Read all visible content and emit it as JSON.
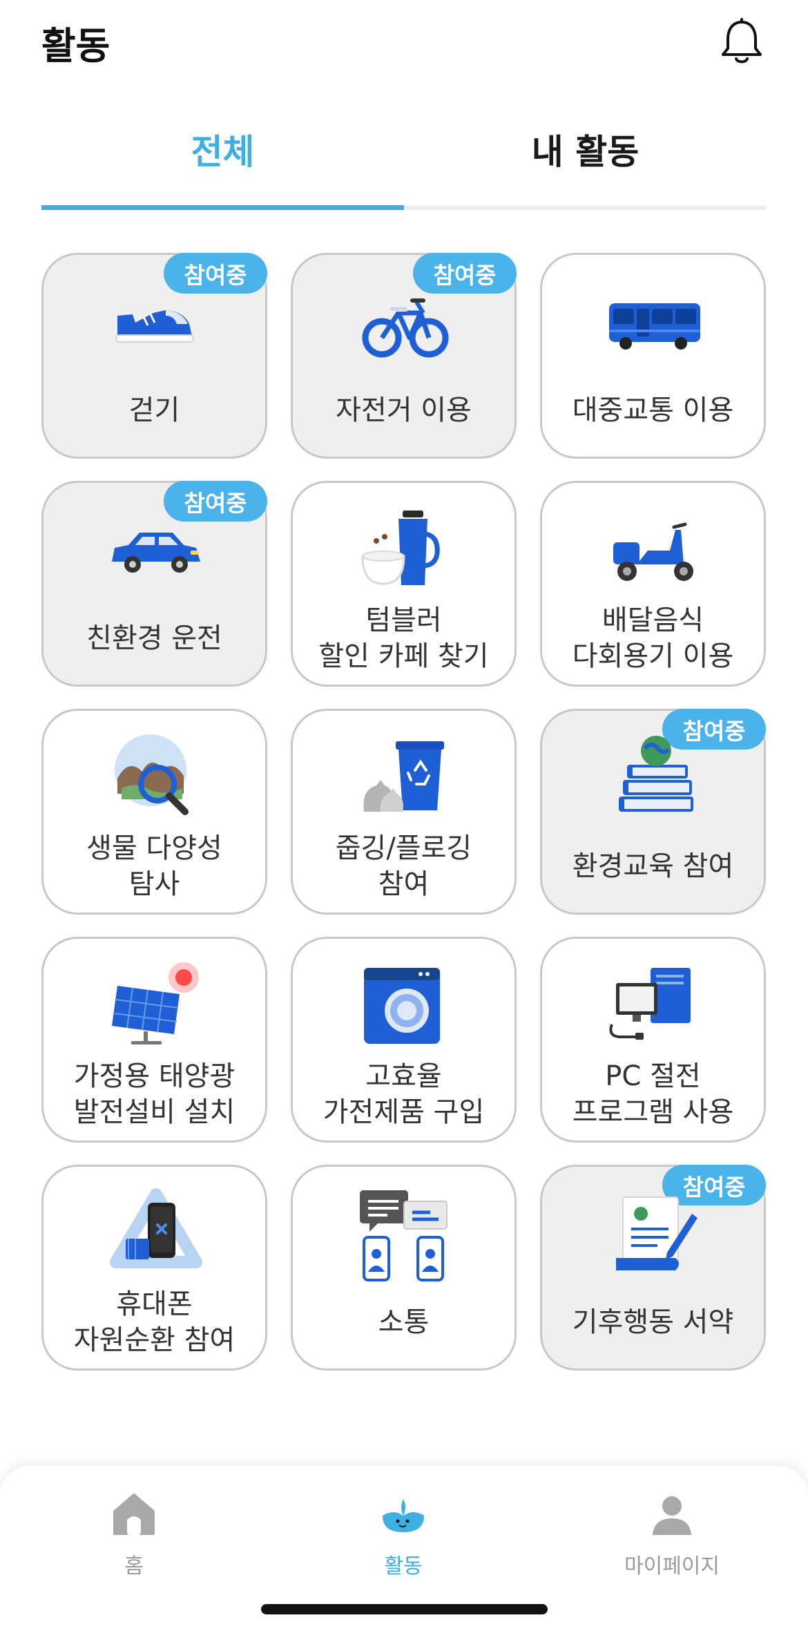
{
  "header": {
    "title": "활동"
  },
  "tabs": [
    {
      "label": "전체",
      "active": true
    },
    {
      "label": "내 활동",
      "active": false
    }
  ],
  "badge_label": "참여중",
  "activities": [
    {
      "label": "걷기",
      "icon": "shoe-icon",
      "joined": true
    },
    {
      "label": "자전거 이용",
      "icon": "bicycle-icon",
      "joined": true
    },
    {
      "label": "대중교통 이용",
      "icon": "bus-icon",
      "joined": false
    },
    {
      "label": "친환경 운전",
      "icon": "car-icon",
      "joined": true
    },
    {
      "label": "텀블러\n할인 카페 찾기",
      "icon": "tumbler-icon",
      "joined": false
    },
    {
      "label": "배달음식\n다회용기 이용",
      "icon": "scooter-icon",
      "joined": false
    },
    {
      "label": "생물 다양성\n탐사",
      "icon": "magnifier-globe-icon",
      "joined": false
    },
    {
      "label": "줍깅/플로깅\n참여",
      "icon": "recycle-bin-icon",
      "joined": false
    },
    {
      "label": "환경교육 참여",
      "icon": "books-globe-icon",
      "joined": true
    },
    {
      "label": "가정용 태양광\n발전설비 설치",
      "icon": "solar-panel-icon",
      "joined": false
    },
    {
      "label": "고효율\n가전제품 구입",
      "icon": "washing-machine-icon",
      "joined": false
    },
    {
      "label": "PC 절전\n프로그램 사용",
      "icon": "computer-icon",
      "joined": false
    },
    {
      "label": "휴대폰\n자원순환 참여",
      "icon": "phone-recycle-icon",
      "joined": false
    },
    {
      "label": "소통",
      "icon": "chat-people-icon",
      "joined": false
    },
    {
      "label": "기후행동 서약",
      "icon": "pledge-document-icon",
      "joined": true
    }
  ],
  "bottom_nav": [
    {
      "label": "홈",
      "icon": "home-icon",
      "active": false
    },
    {
      "label": "활동",
      "icon": "activity-mascot-icon",
      "active": true
    },
    {
      "label": "마이페이지",
      "icon": "person-icon",
      "active": false
    }
  ],
  "colors": {
    "accent": "#3eaee3",
    "badge": "#4ab3ea",
    "icon_blue": "#1f5fd6"
  }
}
